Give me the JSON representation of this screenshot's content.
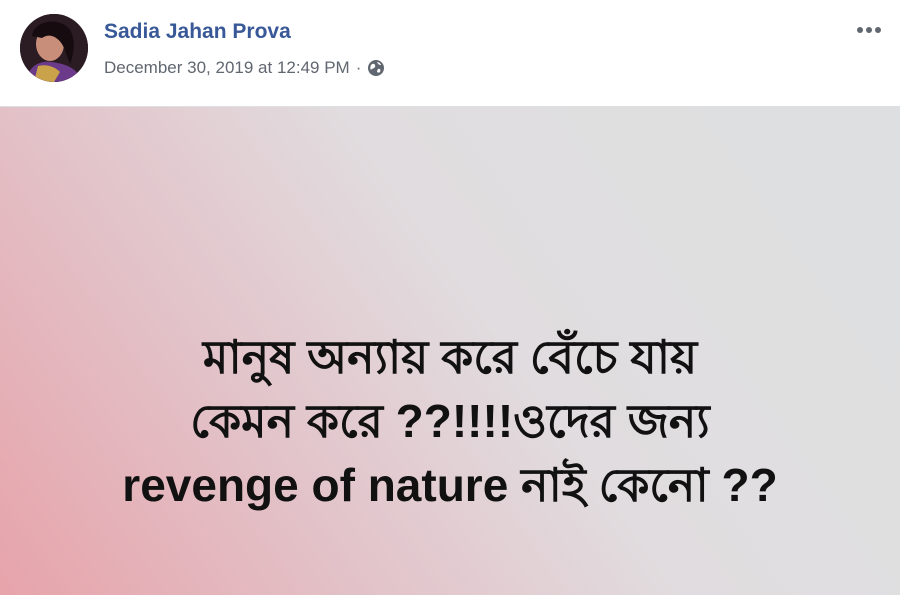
{
  "post": {
    "author_name": "Sadia Jahan Prova",
    "timestamp": "December 30, 2019 at 12:49 PM",
    "separator": "·",
    "privacy_icon": "globe-icon",
    "more_icon": "more-options-icon",
    "body_lines": [
      "মানুষ অন্যায় করে বেঁচে যায়",
      "কেমন করে ??!!!!ওদের জন্য",
      "revenge of nature নাই কেনো ??"
    ]
  },
  "colors": {
    "author_link": "#385898",
    "meta_text": "#606770",
    "background_gradient_start": "#e7a3aa",
    "background_gradient_end": "#dedfe0",
    "post_text": "#111111"
  }
}
